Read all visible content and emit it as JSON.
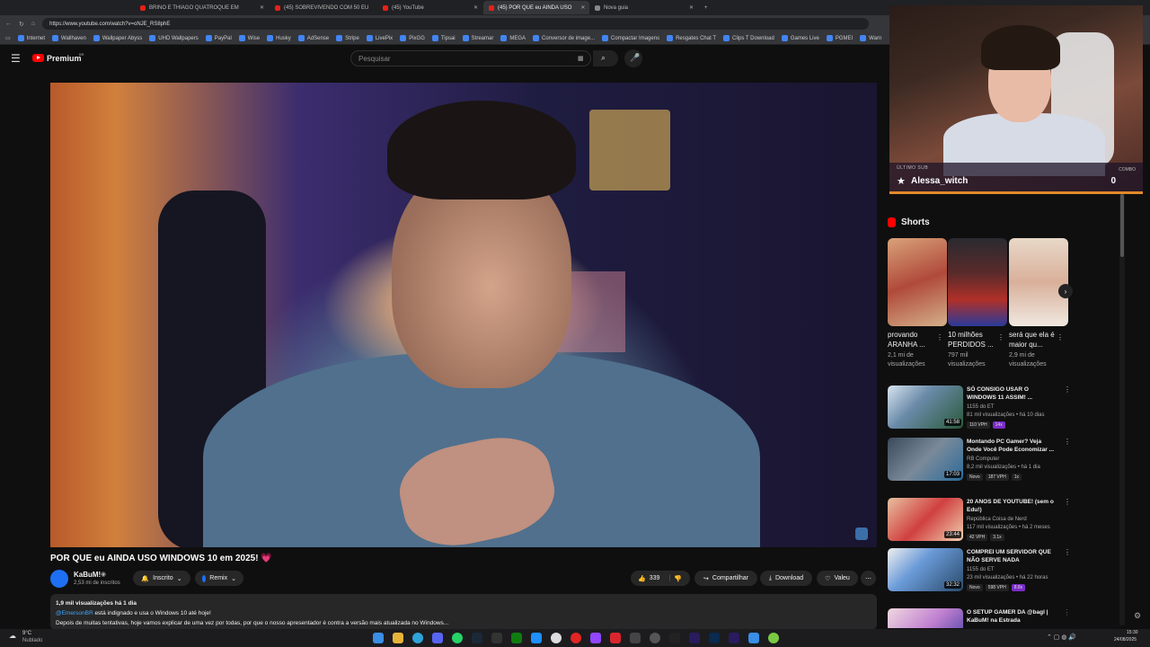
{
  "browser": {
    "tabs": [
      {
        "label": "BRINO E THIAGO QUATROQUE EM",
        "active": false
      },
      {
        "label": "(45) SOBREVIVENDO COM 50 EU",
        "active": false
      },
      {
        "label": "(45) YouTube",
        "active": false
      },
      {
        "label": "(45) POR QUE eu AINDA USO",
        "active": true
      },
      {
        "label": "Nova guia",
        "active": false
      }
    ],
    "url": "https://www.youtube.com/watch?v=oNJE_RS8phE",
    "bookmarks": [
      "Internet",
      "Wallhaven",
      "Wallpaper Abyss",
      "UHD Wallpapers",
      "PayPal",
      "Wise",
      "Husky",
      "AdSense",
      "Stripe",
      "LivePix",
      "PixGG",
      "Tipsai",
      "Streamar",
      "MEGA",
      "Conversor de image...",
      "Compactar Imagens",
      "Resgates Chat T",
      "Clips T Download",
      "Games Live",
      "PGMEI",
      "Warn"
    ]
  },
  "header": {
    "logo": "Premium",
    "logo_region": "BR",
    "search_placeholder": "Pesquisar"
  },
  "video": {
    "title": "POR QUE eu AINDA USO WINDOWS 10 em 2025! 💗",
    "channel": "KaBuM!",
    "subscribers": "2,53 mi de inscritos",
    "subscribed_label": "Inscrito",
    "remix_label": "Remix",
    "likes": "339",
    "share_label": "Compartilhar",
    "download_label": "Download",
    "thanks_label": "Valeu",
    "description": {
      "stats": "1,9 mil visualizações  há 1 dia",
      "mention": "@EmersonBR",
      "line1": " está indignado e usa o Windows 10 até hoje!",
      "line2": "Depois de muitas tentativas, hoje vamos explicar de uma vez por todas, por que o nosso apresentador é contra a versão mais atualizada no Windows..."
    }
  },
  "webcam": {
    "last_sub_label": "ÚLTIMO SUB",
    "last_sub_name": "Alessa_witch",
    "combo_label": "COMBO",
    "combo_value": "0"
  },
  "shorts": {
    "heading": "Shorts",
    "items": [
      {
        "title": "provando ARANHA ...",
        "views": "2,1 mi de visualizações"
      },
      {
        "title": "10 milhões PERDIDOS ...",
        "views": "797 mil visualizações"
      },
      {
        "title": "será que ela é maior qu...",
        "views": "2,9 mi de visualizações"
      }
    ]
  },
  "related": [
    {
      "title": "SÓ CONSIGO USAR O WINDOWS 11 ASSIM! ...",
      "channel": "1155 do ET",
      "meta": "81 mil visualizações • há 10 dias",
      "duration": "41:58",
      "tags": [
        "110 VPH",
        "14x"
      ]
    },
    {
      "title": "Montando PC Gamer? Veja Onde Você Pode Economizar ...",
      "channel": "RB Computer",
      "meta": "8,2 mil visualizações • há 1 dia",
      "duration": "17:03",
      "tags": [
        "Novo",
        "187 VPH",
        "1x"
      ]
    },
    {
      "title": "20 ANOS DE YOUTUBE! (sem o Edu!)",
      "channel": "República Coisa de Nerd",
      "meta": "117 mil visualizações • há 2 meses",
      "duration": "23:44",
      "tags": [
        "42 VPH",
        "3.1x"
      ]
    },
    {
      "title": "COMPREI UM SERVIDOR QUE NÃO SERVE NADA",
      "channel": "1155 do ET",
      "meta": "23 mil visualizações • há 22 horas",
      "duration": "32:32",
      "tags": [
        "Novo",
        "598 VPH",
        "8.8x"
      ]
    },
    {
      "title": "O SETUP GAMER DA @bagl | KaBuM! na Estrada",
      "channel": "",
      "meta": "",
      "duration": "",
      "tags": []
    }
  ],
  "taskbar": {
    "weather_temp": "9°C",
    "weather_text": "Nublado",
    "time": "15:30",
    "date": "24/08/2025"
  },
  "colors": {
    "accent_red": "#ff0000",
    "link_blue": "#3ea6ff",
    "background": "#0f0f0f"
  }
}
